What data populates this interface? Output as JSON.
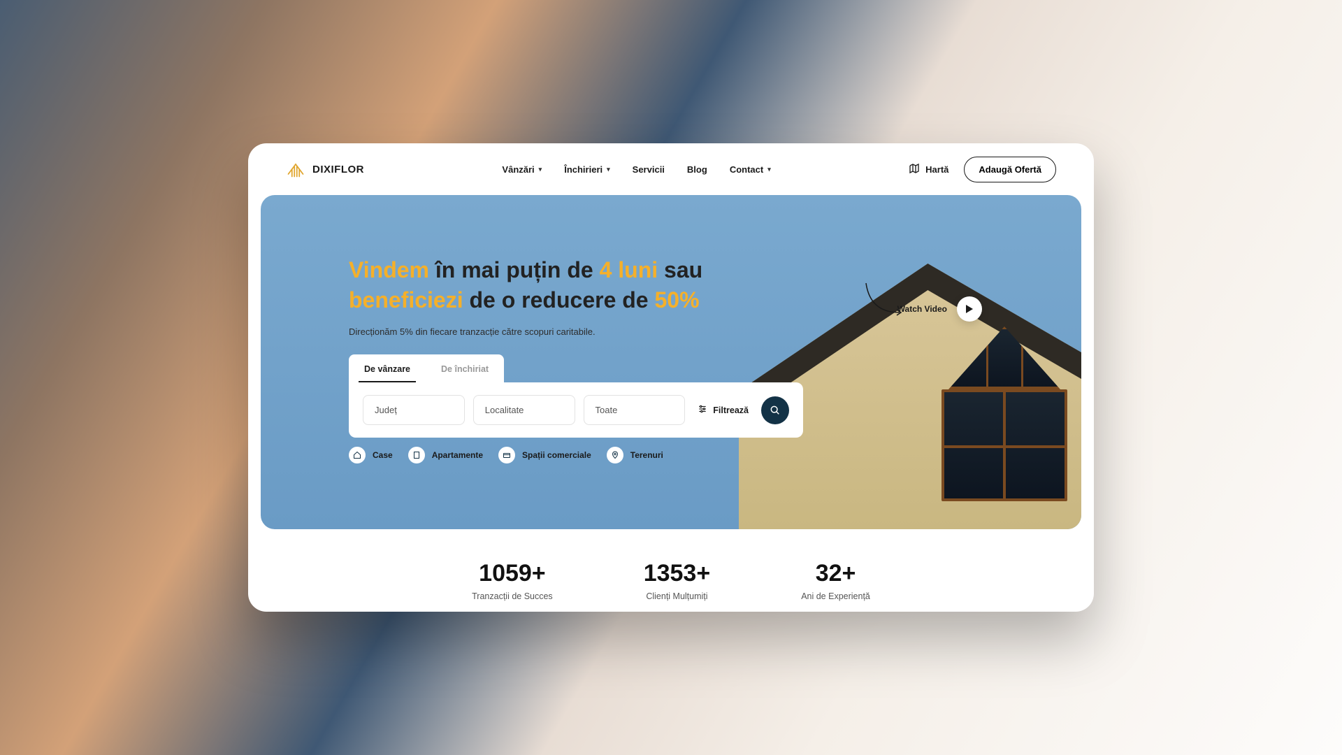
{
  "brand": {
    "name": "DIXIFLOR"
  },
  "nav": {
    "items": [
      {
        "label": "Vânzări",
        "dropdown": true
      },
      {
        "label": "Închirieri",
        "dropdown": true
      },
      {
        "label": "Servicii",
        "dropdown": false
      },
      {
        "label": "Blog",
        "dropdown": false
      },
      {
        "label": "Contact",
        "dropdown": true
      }
    ],
    "map_label": "Hartă",
    "cta_label": "Adaugă Ofertă"
  },
  "hero": {
    "headline": {
      "p1_accent": "Vindem",
      "p2": " în mai puțin de ",
      "p3_accent": "4 luni",
      "p4": " sau ",
      "p5_accent": "beneficiezi",
      "p6": " de o reducere de ",
      "p7_accent": "50%"
    },
    "subtitle": "Direcționăm 5% din fiecare tranzacție către scopuri caritabile.",
    "watch_label": "Watch Video"
  },
  "search": {
    "tabs": {
      "sale": "De vânzare",
      "rent": "De închiriat"
    },
    "selects": {
      "judet": "Județ",
      "localitate": "Localitate",
      "toate": "Toate"
    },
    "filter_label": "Filtrează"
  },
  "chips": {
    "case": "Case",
    "apartamente": "Apartamente",
    "spatii": "Spații comerciale",
    "terenuri": "Terenuri"
  },
  "stats": [
    {
      "value": "1059+",
      "label": "Tranzacții de Succes"
    },
    {
      "value": "1353+",
      "label": "Clienți Mulțumiți"
    },
    {
      "value": "32+",
      "label": "Ani de Experiență"
    }
  ]
}
